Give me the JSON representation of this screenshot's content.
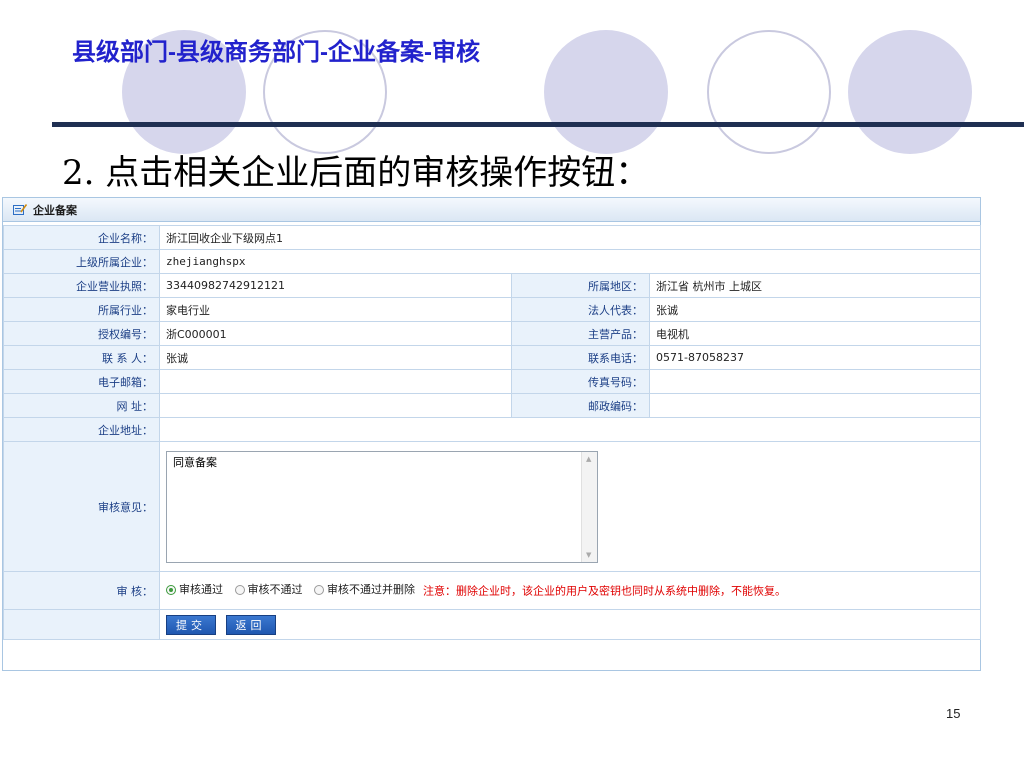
{
  "slide": {
    "title": "县级部门-县级商务部门-企业备案-审核",
    "heading": "2. 点击相关企业后面的审核操作按钮：",
    "page_number": "15"
  },
  "panel": {
    "title": "企业备案",
    "icon": "edit-icon"
  },
  "form": {
    "company_name": {
      "label": "企业名称：",
      "value": "浙江回收企业下级网点1"
    },
    "parent_company": {
      "label": "上级所属企业：",
      "value": "zhejianghspx"
    },
    "business_license": {
      "label": "企业营业执照：",
      "value": "33440982742912121"
    },
    "region": {
      "label": "所属地区：",
      "value": "浙江省 杭州市 上城区"
    },
    "industry": {
      "label": "所属行业：",
      "value": "家电行业"
    },
    "legal_rep": {
      "label": "法人代表：",
      "value": "张诚"
    },
    "auth_code": {
      "label": "授权编号：",
      "value": "浙C000001"
    },
    "main_product": {
      "label": "主营产品：",
      "value": "电视机"
    },
    "contact": {
      "label": "联 系 人：",
      "value": "张诚"
    },
    "phone": {
      "label": "联系电话：",
      "value": "0571-87058237"
    },
    "email": {
      "label": "电子邮箱：",
      "value": ""
    },
    "fax": {
      "label": "传真号码：",
      "value": ""
    },
    "website": {
      "label": "网 址：",
      "value": ""
    },
    "postcode": {
      "label": "邮政编码：",
      "value": ""
    },
    "address": {
      "label": "企业地址：",
      "value": ""
    },
    "opinion": {
      "label": "审核意见：",
      "value": "同意备案"
    },
    "review": {
      "label": "审 核：",
      "options": [
        "审核通过",
        "审核不通过",
        "审核不通过并删除"
      ],
      "selected": "审核通过",
      "warning": "注意：删除企业时，该企业的用户及密钥也同时从系统中删除，不能恢复。"
    },
    "buttons": {
      "submit": "提交",
      "back": "返回"
    }
  },
  "colors": {
    "title": "#2222cc",
    "label_text": "#1c3f86",
    "label_bg": "#e9f2fb",
    "warning": "#e00000",
    "button": "#2563c2"
  }
}
